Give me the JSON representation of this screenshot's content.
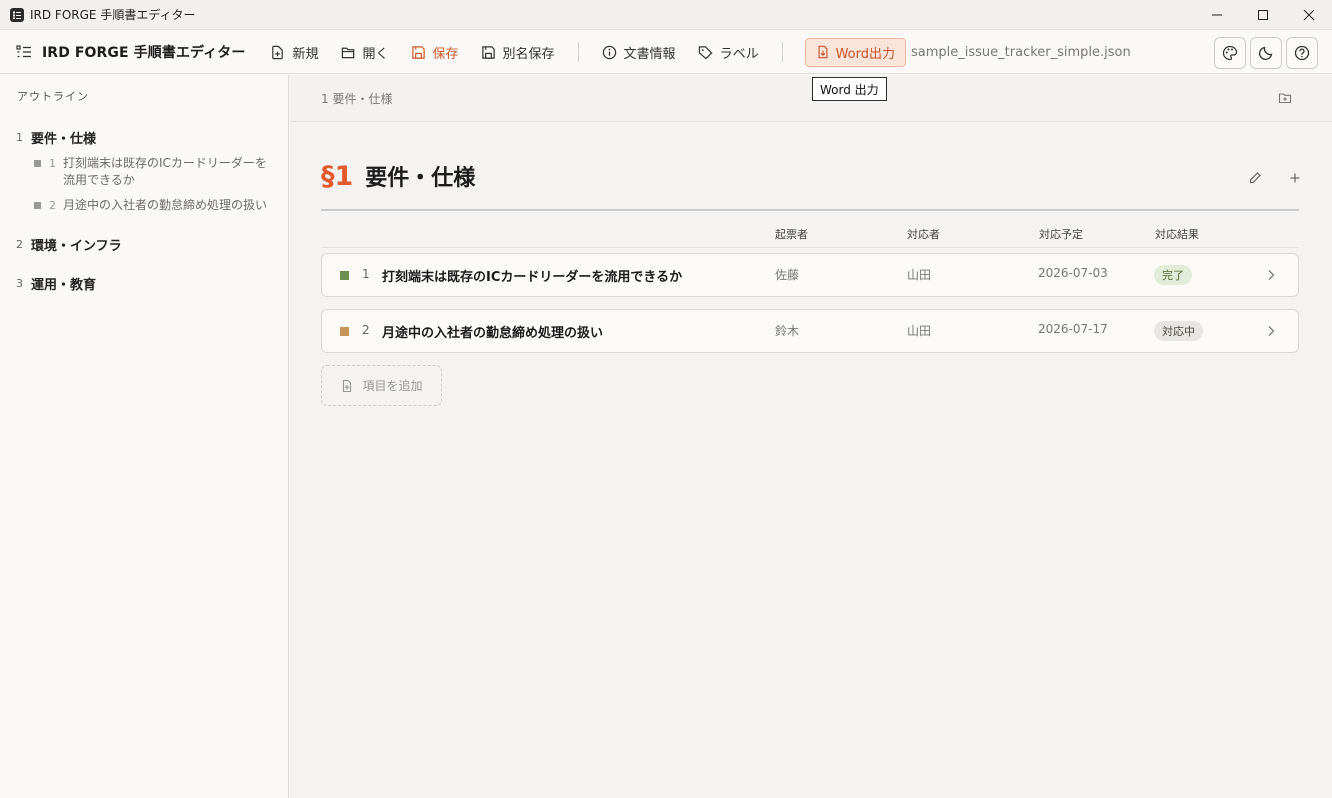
{
  "window": {
    "title": "IRD FORGE 手順書エディター"
  },
  "toolbar": {
    "brand": "IRD FORGE 手順書エディター",
    "new_label": "新規",
    "open_label": "開く",
    "save_label": "保存",
    "save_as_label": "別名保存",
    "doc_info_label": "文書情報",
    "label_label": "ラベル",
    "word_label": "Word出力",
    "filename": "sample_issue_tracker_simple.json"
  },
  "tooltip": {
    "text": "Word 出力"
  },
  "sidebar": {
    "heading": "アウトライン",
    "sections": [
      {
        "num": "1",
        "label": "要件・仕様",
        "items": [
          {
            "num": "1",
            "label": "打刻端末は既存のICカードリーダーを流用できるか"
          },
          {
            "num": "2",
            "label": "月途中の入社者の勤怠締め処理の扱い"
          }
        ]
      },
      {
        "num": "2",
        "label": "環境・インフラ"
      },
      {
        "num": "3",
        "label": "運用・教育"
      }
    ]
  },
  "main": {
    "breadcrumb": "1 要件・仕様",
    "section_mark": "§1",
    "section_title": "要件・仕様",
    "columns": {
      "creator": "起票者",
      "assignee": "対応者",
      "due": "対応予定",
      "result": "対応結果"
    },
    "rows": [
      {
        "num": "1",
        "title": "打刻端末は既存のICカードリーダーを流用できるか",
        "creator": "佐藤",
        "assignee": "山田",
        "due": "2026-07-03",
        "status": "完了",
        "color": "#6a8f4e"
      },
      {
        "num": "2",
        "title": "月途中の入社者の勤怠締め処理の扱い",
        "creator": "鈴木",
        "assignee": "山田",
        "due": "2026-07-17",
        "status": "対応中",
        "color": "#c59558"
      }
    ],
    "add_item_label": "項目を追加"
  },
  "colors": {
    "accent": "#e25a2c",
    "done_badge": "#e3ecd8",
    "progress_badge": "#e8e6e2"
  },
  "icons": {
    "app": "app-icon",
    "minimize": "minimize-icon",
    "maximize": "maximize-icon",
    "close": "close-icon",
    "palette": "palette-icon",
    "theme": "moon-icon",
    "help": "help-icon"
  }
}
